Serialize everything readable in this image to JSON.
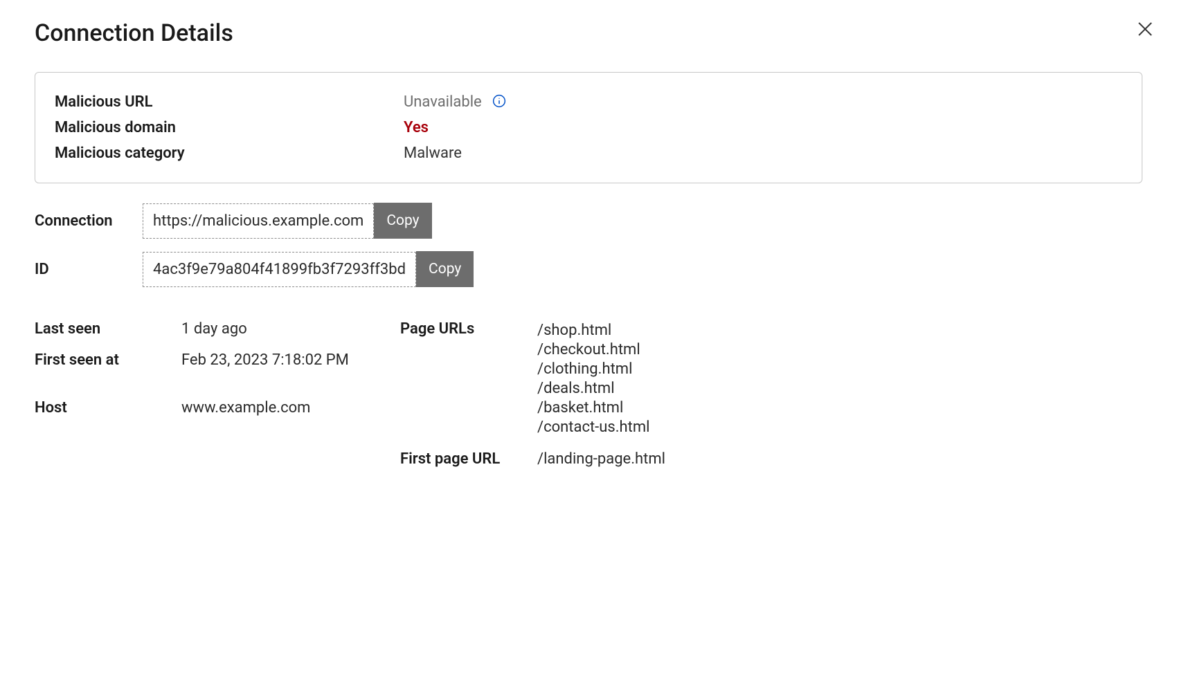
{
  "title": "Connection Details",
  "card": {
    "malicious_url_label": "Malicious URL",
    "malicious_url_value": "Unavailable",
    "malicious_domain_label": "Malicious domain",
    "malicious_domain_value": "Yes",
    "malicious_category_label": "Malicious category",
    "malicious_category_value": "Malware"
  },
  "connection": {
    "label": "Connection",
    "value": "https://malicious.example.com",
    "copy": "Copy"
  },
  "id": {
    "label": "ID",
    "value": "4ac3f9e79a804f41899fb3f7293ff3bd",
    "copy": "Copy"
  },
  "meta": {
    "last_seen_label": "Last seen",
    "last_seen_value": "1 day ago",
    "first_seen_label": "First seen at",
    "first_seen_value": "Feb 23, 2023 7:18:02 PM",
    "host_label": "Host",
    "host_value": "www.example.com",
    "page_urls_label": "Page URLs",
    "page_urls": [
      "/shop.html",
      "/checkout.html",
      "/clothing.html",
      "/deals.html",
      "/basket.html",
      "/contact-us.html"
    ],
    "first_page_url_label": "First page URL",
    "first_page_url_value": "/landing-page.html"
  }
}
